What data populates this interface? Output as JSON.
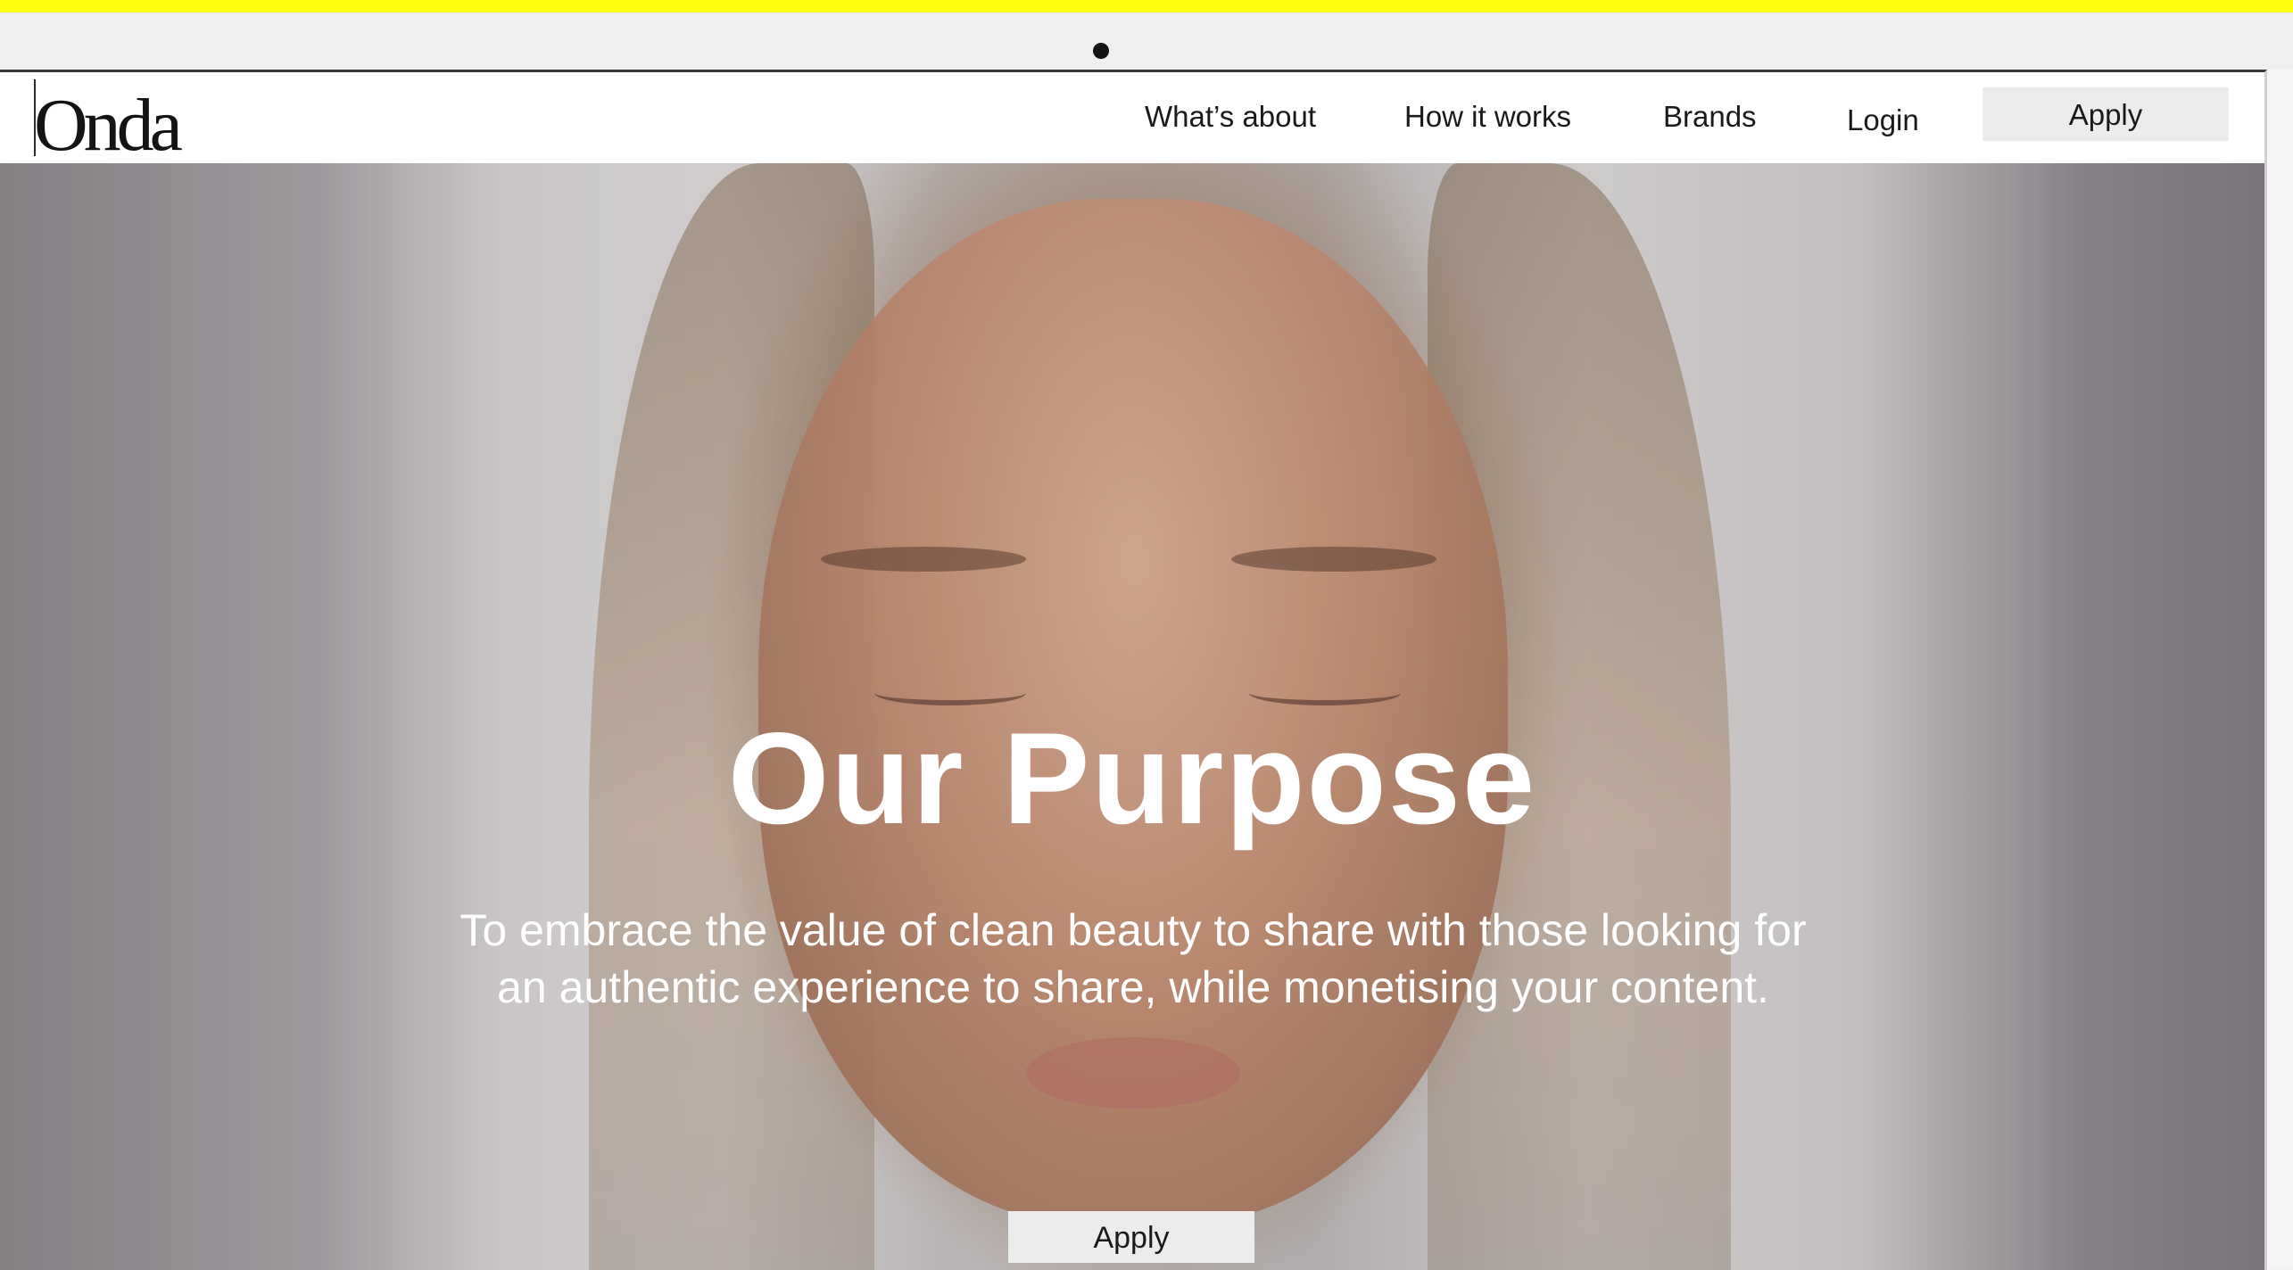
{
  "brand": {
    "logo": "Onda"
  },
  "nav": {
    "items": [
      {
        "label": "What’s about"
      },
      {
        "label": "How it works"
      },
      {
        "label": "Brands"
      },
      {
        "label": "Login"
      }
    ],
    "apply_label": "Apply"
  },
  "hero": {
    "title": "Our Purpose",
    "subtitle": "To embrace the value of clean beauty to share with those looking for an authentic experience to share, while monetising your content.",
    "apply_label": "Apply",
    "image": "portrait-photo"
  },
  "colors": {
    "top_bar": "#ffff14",
    "button_bg": "#ececec",
    "hero_text": "#ffffff",
    "nav_text": "#1a1a1a"
  }
}
